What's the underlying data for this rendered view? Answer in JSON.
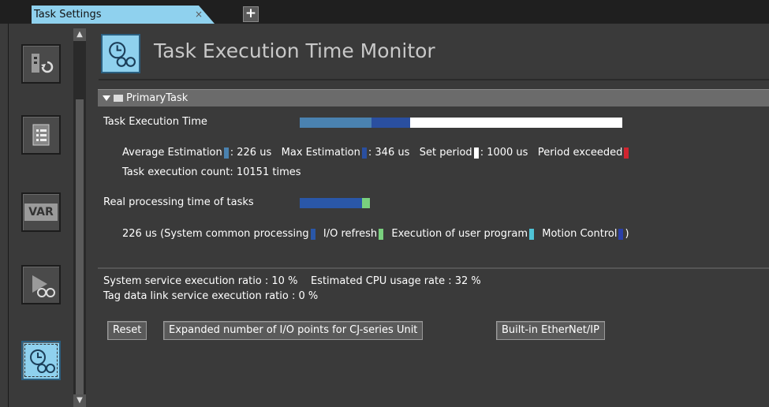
{
  "tab": {
    "label": "Task Settings",
    "close": "×",
    "add": "+"
  },
  "page": {
    "title": "Task Execution Time Monitor"
  },
  "section": {
    "name": "PrimaryTask"
  },
  "task_exec": {
    "label": "Task Execution Time",
    "avg_label": "Average Estimation",
    "avg_value": ": 226 us",
    "max_label": "Max Estimation",
    "max_value": ": 346 us",
    "period_label": "Set period",
    "period_value": ": 1000 us",
    "exceeded_label": "Period exceeded",
    "count_label": "Task execution count",
    "count_value": ": 10151 times",
    "bar": {
      "avg_us": 226,
      "max_us": 346,
      "period_us": 1000
    },
    "colors": {
      "avg": "#4a82b0",
      "max": "#2a4fa0",
      "period": "#ffffff",
      "exceeded": "#d0242f"
    }
  },
  "real_proc": {
    "label": "Real processing time of tasks",
    "total": "226 us (",
    "sys": "System common processing",
    "io": "I/O refresh",
    "user": "Execution of user program",
    "motion": "Motion Control",
    "close": ")",
    "colors": {
      "sys": "#2a57a8",
      "io": "#79d07e",
      "user": "#4fc3d6",
      "motion": "#2a3fa8"
    }
  },
  "stats": {
    "sys_ratio": "System service execution ratio : 10 %",
    "cpu_usage": "Estimated CPU usage rate : 32 %",
    "tag_ratio": "Tag data link service execution ratio : 0 %"
  },
  "buttons": {
    "reset": "Reset",
    "expanded": "Expanded number of I/O points for CJ-series Unit",
    "ethernet": "Built-in EtherNet/IP"
  },
  "sidebar": {
    "icons": [
      "task-return-icon",
      "task-list-icon",
      "var-icon",
      "task-monitor-icon",
      "execution-time-monitor-icon"
    ],
    "var_text": "VAR"
  }
}
